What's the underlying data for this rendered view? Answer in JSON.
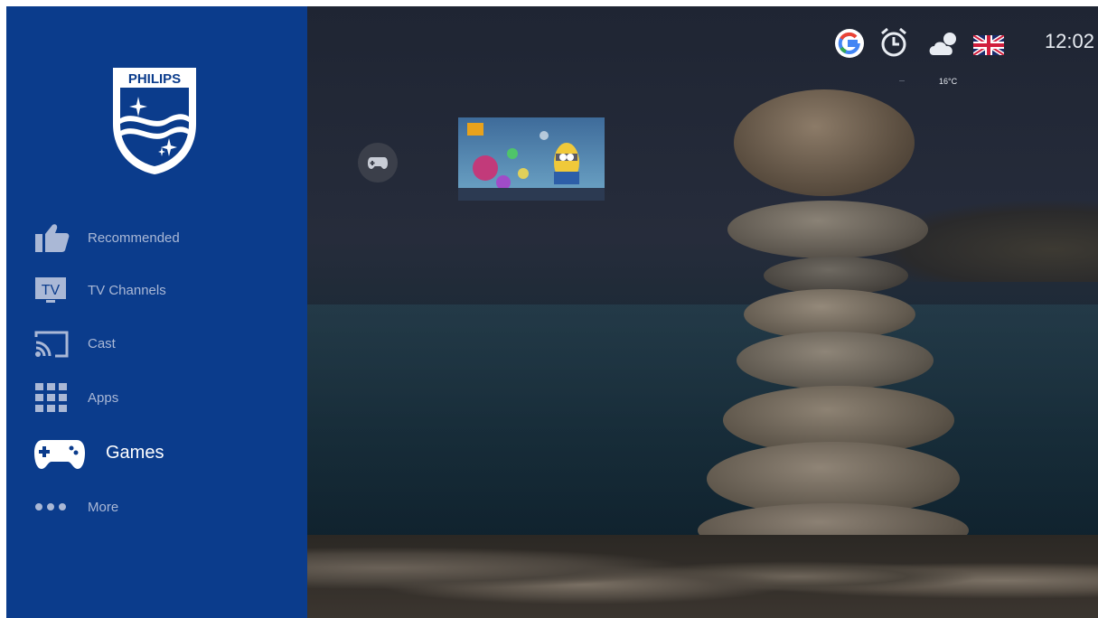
{
  "brand": {
    "name": "PHILIPS"
  },
  "sidebar": {
    "items": [
      {
        "label": "Recommended",
        "icon": "thumbs-up-icon",
        "active": false
      },
      {
        "label": "TV Channels",
        "icon": "tv-icon",
        "active": false
      },
      {
        "label": "Cast",
        "icon": "cast-icon",
        "active": false
      },
      {
        "label": "Apps",
        "icon": "apps-grid-icon",
        "active": false
      },
      {
        "label": "Games",
        "icon": "gamepad-icon",
        "active": true
      },
      {
        "label": "More",
        "icon": "more-dots-icon",
        "active": false
      }
    ]
  },
  "status_bar": {
    "google_icon": "google-icon",
    "alarm_icon": "alarm-clock-icon",
    "weather_icon": "weather-cloud-sun-icon",
    "temperature": "16°C",
    "language_icon": "uk-flag-icon",
    "time": "12:02"
  },
  "content": {
    "row_icon": "gamepad-icon",
    "tiles": [
      {
        "kind": "game-thumbnail"
      }
    ]
  },
  "colors": {
    "sidebar": "#0b3c8c",
    "sidebar_text": "#aab8d6",
    "active_text": "#ffffff"
  }
}
